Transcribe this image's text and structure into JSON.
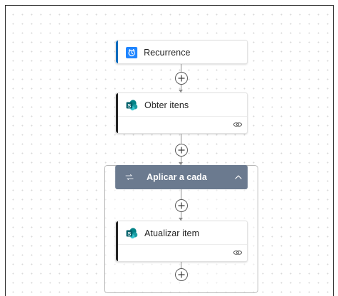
{
  "flow": {
    "trigger": {
      "title": "Recurrence",
      "icon": "clock-icon",
      "accent": "#0f6cbd",
      "icon_bg": "#1f85ff"
    },
    "action_get": {
      "title": "Obter itens",
      "icon": "sharepoint-icon",
      "accent": "#242424"
    },
    "loop": {
      "title": "Aplicar a cada",
      "icon": "loop-icon",
      "header_color": "#6b7a8f"
    },
    "action_update": {
      "title": "Atualizar item",
      "icon": "sharepoint-icon",
      "accent": "#242424"
    }
  },
  "colors": {
    "sharepoint_teal": "#038387",
    "sharepoint_dark": "#05616b",
    "plus_border": "#5c5c5c",
    "connector": "#8a8a8a"
  }
}
